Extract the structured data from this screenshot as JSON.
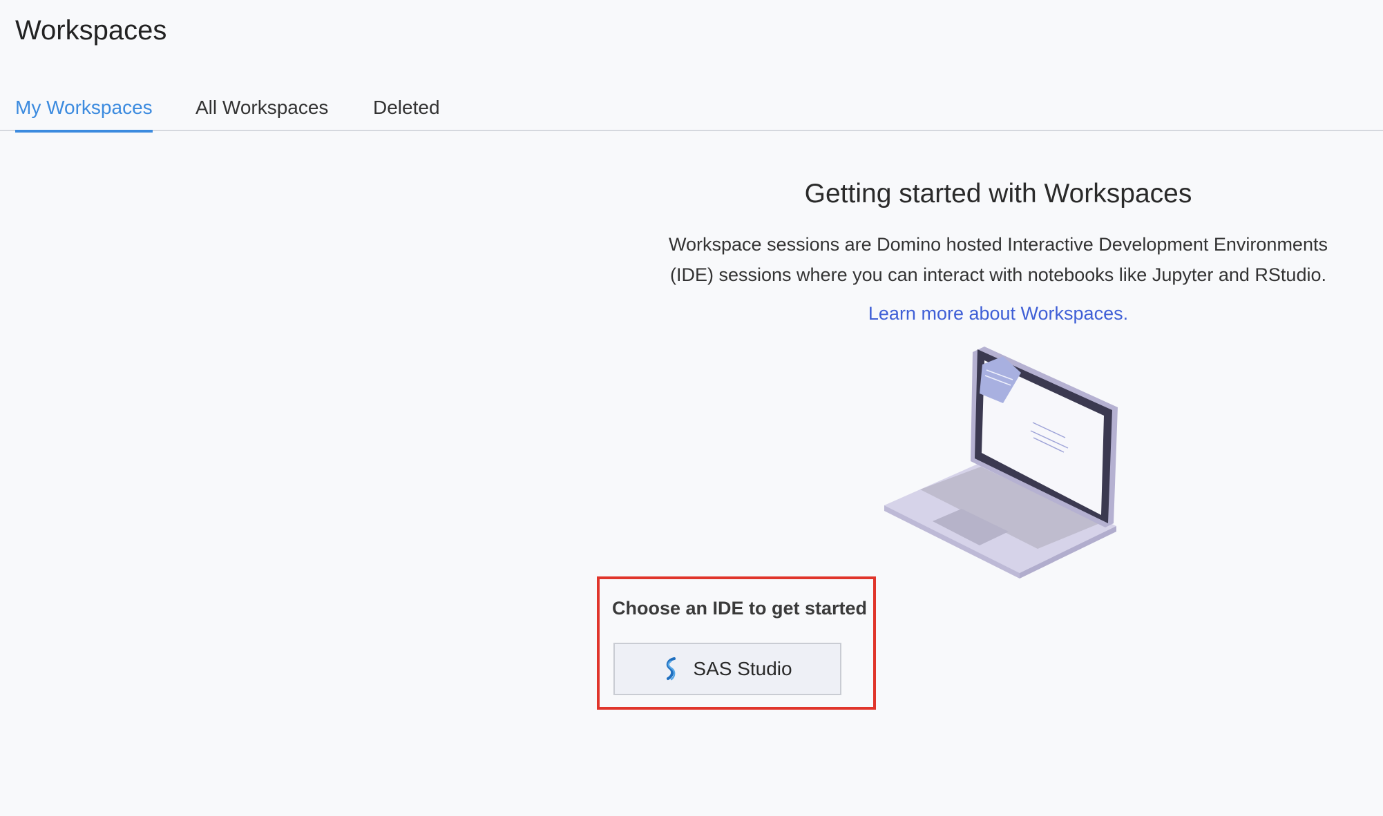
{
  "page": {
    "title": "Workspaces"
  },
  "tabs": [
    {
      "label": "My Workspaces",
      "active": true
    },
    {
      "label": "All Workspaces",
      "active": false
    },
    {
      "label": "Deleted",
      "active": false
    }
  ],
  "getting_started": {
    "heading": "Getting started with Workspaces",
    "description": "Workspace sessions are Domino hosted Interactive Development Environments (IDE) sessions where you can interact with notebooks like Jupyter and RStudio.",
    "link_text": "Learn more about Workspaces."
  },
  "ide_chooser": {
    "heading": "Choose an IDE to get started",
    "options": [
      {
        "label": "SAS Studio",
        "icon": "sas-logo-icon"
      }
    ]
  },
  "colors": {
    "accent": "#3c8bdf",
    "link": "#3f5fd6",
    "highlight_border": "#e0352b",
    "illustration": "#c7c3de"
  }
}
